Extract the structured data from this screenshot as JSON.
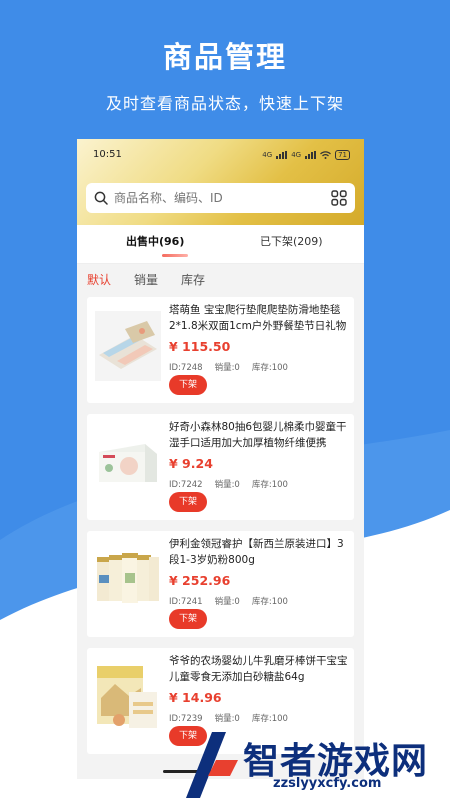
{
  "promo": {
    "title": "商品管理",
    "subtitle": "及时查看商品状态，快速上下架"
  },
  "status_bar": {
    "time": "10:51",
    "network_1": "4G",
    "network_2": "4G",
    "battery": "71"
  },
  "search": {
    "placeholder": "商品名称、编码、ID",
    "scan_icon": "scan-grid-icon"
  },
  "tabs": [
    {
      "label": "出售中(96)",
      "active": true
    },
    {
      "label": "已下架(209)",
      "active": false
    }
  ],
  "sort_options": [
    {
      "label": "默认",
      "active": true
    },
    {
      "label": "销量",
      "active": false
    },
    {
      "label": "库存",
      "active": false
    }
  ],
  "products": [
    {
      "name": "塔萌鱼 宝宝爬行垫爬爬垫防滑地垫毯2*1.8米双面1cm户外野餐垫节日礼物",
      "price": "¥ 115.50",
      "id": "ID:7248",
      "sales": "销量:0",
      "stock": "库存:100",
      "action": "下架"
    },
    {
      "name": "好奇小森林80抽6包婴儿棉柔巾婴童干湿手口适用加大加厚植物纤维便携",
      "price": "¥ 9.24",
      "id": "ID:7242",
      "sales": "销量:0",
      "stock": "库存:100",
      "action": "下架"
    },
    {
      "name": "伊利金领冠睿护【新西兰原装进口】3段1-3岁奶粉800g",
      "price": "¥ 252.96",
      "id": "ID:7241",
      "sales": "销量:0",
      "stock": "库存:100",
      "action": "下架"
    },
    {
      "name": "爷爷的农场婴幼儿牛乳磨牙棒饼干宝宝儿童零食无添加白砂糖盐64g",
      "price": "¥ 14.96",
      "id": "ID:7239",
      "sales": "销量:0",
      "stock": "库存:100",
      "action": "下架"
    }
  ],
  "watermark": {
    "name": "智者游戏网",
    "url": "zzslyyxcfy.com"
  },
  "colors": {
    "background": "#3f8ce8",
    "accent": "#e83a29",
    "header_gold": "#e3c046"
  }
}
